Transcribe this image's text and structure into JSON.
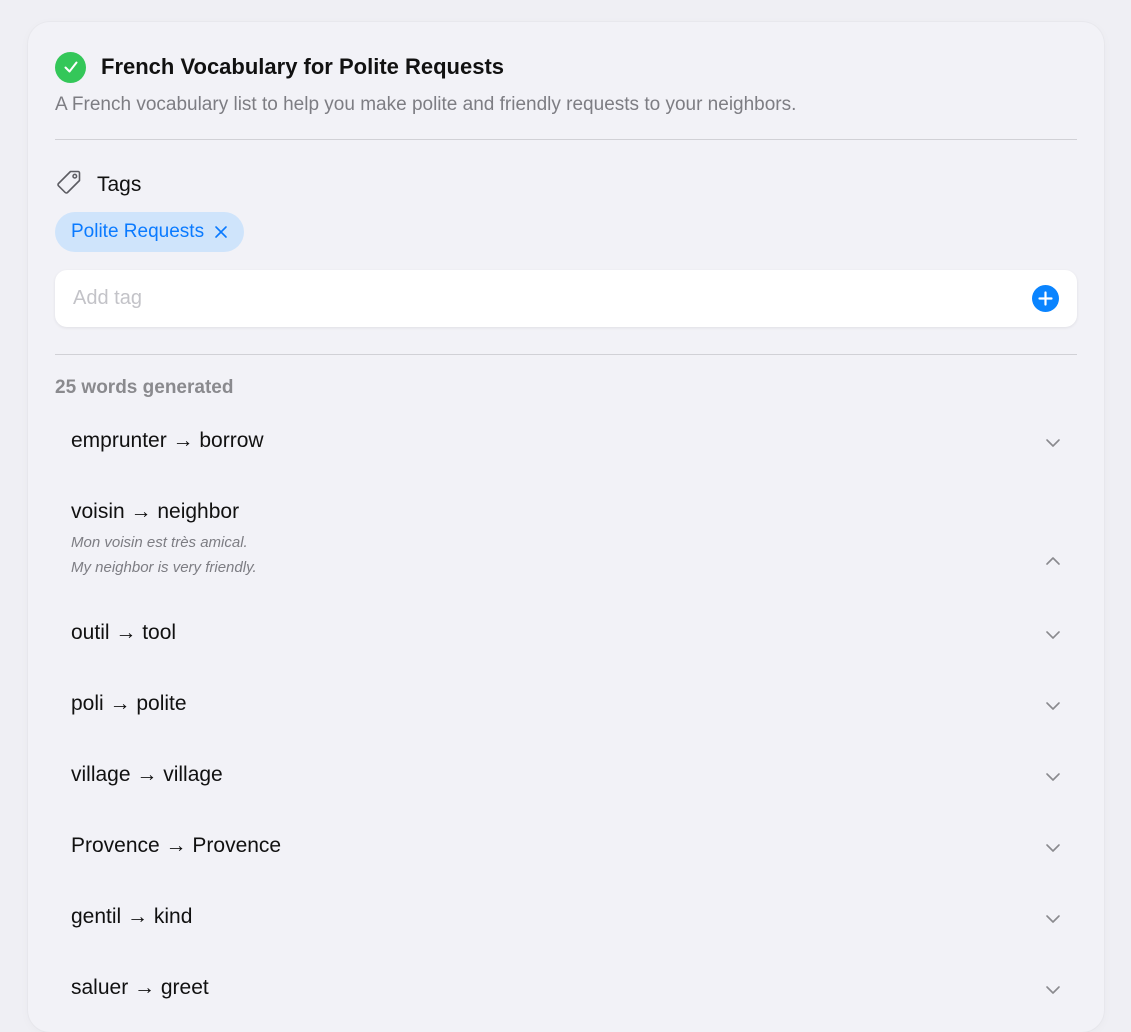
{
  "header": {
    "title": "French Vocabulary for Polite Requests",
    "description": "A French vocabulary list to help you make polite and friendly requests to your neighbors.",
    "status_icon": "checkmark-circle-icon"
  },
  "tags": {
    "heading": "Tags",
    "icon": "tag-icon",
    "items": [
      {
        "label": "Polite Requests"
      }
    ],
    "input_placeholder": "Add tag",
    "input_value": ""
  },
  "words": {
    "count_label": "25 words generated",
    "items": [
      {
        "text": "emprunter → borrow",
        "expanded": false
      },
      {
        "text": "voisin → neighbor",
        "expanded": true,
        "example_fr": "Mon voisin est très amical.",
        "example_en": "My neighbor is very friendly."
      },
      {
        "text": "outil → tool",
        "expanded": false
      },
      {
        "text": "poli → polite",
        "expanded": false
      },
      {
        "text": "village → village",
        "expanded": false
      },
      {
        "text": "Provence → Provence",
        "expanded": false
      },
      {
        "text": "gentil → kind",
        "expanded": false
      },
      {
        "text": "saluer → greet",
        "expanded": false
      }
    ]
  },
  "colors": {
    "accent": "#0a84ff",
    "success": "#34c759",
    "chip_bg": "#cfe4fb"
  }
}
